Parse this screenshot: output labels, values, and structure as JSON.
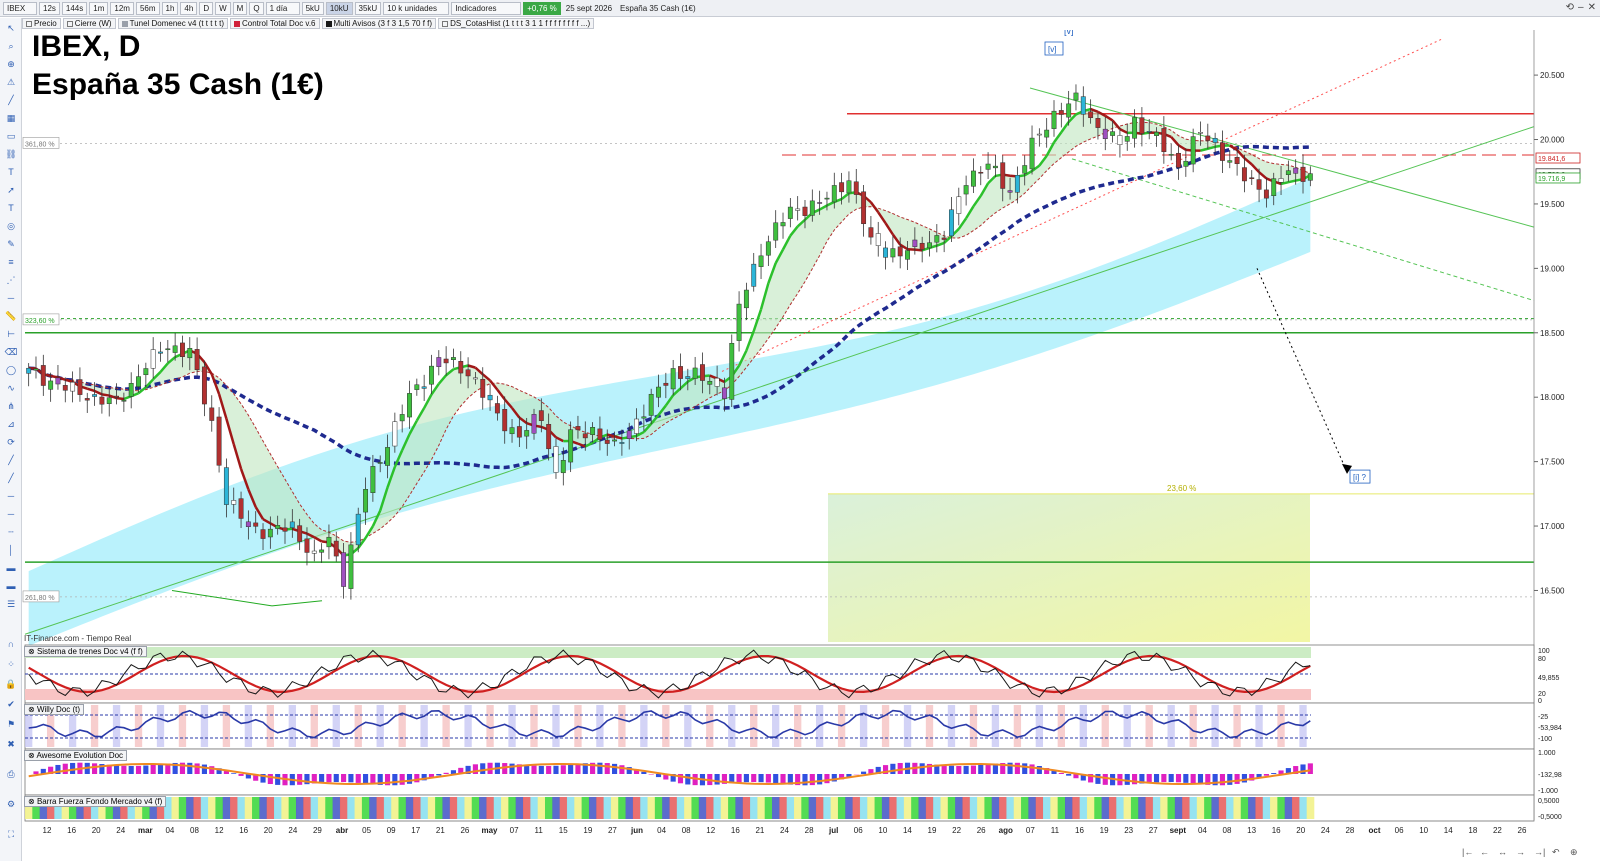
{
  "toolbar": {
    "symbol": "IBEX",
    "timeframes": [
      "12s",
      "144s",
      "1m",
      "12m",
      "56m",
      "1h",
      "4h",
      "D",
      "W",
      "M",
      "Q"
    ],
    "active_timeframe": "D",
    "period": "1 día",
    "volumes": [
      "5kU",
      "10kU",
      "35kU"
    ],
    "active_volume": "10kU",
    "units": "10 k unidades",
    "indicators_label": "Indicadores",
    "change_badge": "+0,76 %",
    "date": "25 sept 2026",
    "instrument": "España 35 Cash (1€)"
  },
  "indicator_tabs": [
    {
      "label": "Precio",
      "color": "#ffffff"
    },
    {
      "label": "Cierre (W)",
      "color": "#ffffff"
    },
    {
      "label": "Tunel Domenec v4 (t t t t t)",
      "color": "#9aa0aa"
    },
    {
      "label": "Control Total Doc v.6",
      "color": "#d0203a"
    },
    {
      "label": "Multi Avisos (3 f 3 1,5 70 f f)",
      "color": "#1a1a1a"
    },
    {
      "label": "DS_CotasHist (1 t t t 3 1 1 f f f f f f f f ...)",
      "color": "#ffffff"
    }
  ],
  "title": {
    "line1": "IBEX, D",
    "line2": "España 35 Cash (1€)"
  },
  "source": "IT-Finance.com - Tiempo Real",
  "price_axis": {
    "ticks": [
      "20.500",
      "20.000",
      "19.500",
      "19.000",
      "18.500",
      "18.000",
      "17.500",
      "17.000",
      "16.500"
    ],
    "tags": [
      {
        "label": "19.841,6",
        "color": "#cc2222",
        "value": 19841
      },
      {
        "label": "19.733,9",
        "color": "#333333",
        "value": 19734
      },
      {
        "label": "19.716,9",
        "color": "#2aa02a",
        "value": 19717
      }
    ]
  },
  "fib_labels": [
    {
      "label": "361,80 %",
      "value": 19970
    },
    {
      "label": "323,60 %",
      "value": 18600
    },
    {
      "label": "261,80 %",
      "value": 16450
    }
  ],
  "annotations": {
    "wave_top": "[v]",
    "wave_top2": "[v]",
    "target": "[i] ?",
    "fib_2360": "23,60 %"
  },
  "panels": [
    {
      "label": "Sistema de trenes Doc v4 (f f)",
      "axis": [
        "100",
        "80",
        "49,855",
        "20",
        "0"
      ]
    },
    {
      "label": "Willy Doc (t)",
      "axis": [
        "-25",
        "-53,984",
        "-100"
      ]
    },
    {
      "label": "Awesome Evolution Doc",
      "axis": [
        "1.000",
        "-132,98",
        "-1.000"
      ]
    },
    {
      "label": "Barra Fuerza Fondo Mercado v4 (f)",
      "axis": [
        "0,5000",
        "-0,5000"
      ]
    }
  ],
  "date_axis": {
    "labels": [
      "12",
      "16",
      "20",
      "24",
      "mar",
      "04",
      "08",
      "12",
      "16",
      "20",
      "24",
      "29",
      "abr",
      "05",
      "09",
      "17",
      "21",
      "26",
      "may",
      "07",
      "11",
      "15",
      "19",
      "27",
      "jun",
      "04",
      "08",
      "12",
      "16",
      "21",
      "24",
      "28",
      "jul",
      "06",
      "10",
      "14",
      "19",
      "22",
      "26",
      "ago",
      "07",
      "11",
      "16",
      "19",
      "23",
      "27",
      "sept",
      "04",
      "08",
      "13",
      "16",
      "20",
      "24",
      "28",
      "oct",
      "06",
      "10",
      "14",
      "18",
      "22",
      "26"
    ]
  },
  "chart_data": {
    "type": "candlestick",
    "title": "IBEX, D",
    "subtitle": "España 35 Cash (1€)",
    "ylim": [
      16100,
      20850
    ],
    "horizontal_levels": [
      {
        "value": 20200,
        "color": "#e03030",
        "style": "solid"
      },
      {
        "value": 19880,
        "color": "#e03030",
        "style": "dashed"
      },
      {
        "value": 18500,
        "color": "#2aa02a",
        "style": "solid"
      },
      {
        "value": 18610,
        "color": "#2aa02a",
        "style": "dotted"
      },
      {
        "value": 16720,
        "color": "#2aa02a",
        "style": "solid"
      }
    ],
    "close_keypoints": [
      [
        0,
        18200
      ],
      [
        6,
        18050
      ],
      [
        12,
        17950
      ],
      [
        16,
        18250
      ],
      [
        19,
        18400
      ],
      [
        22,
        18350
      ],
      [
        25,
        17800
      ],
      [
        27,
        17200
      ],
      [
        30,
        17000
      ],
      [
        33,
        16950
      ],
      [
        36,
        17000
      ],
      [
        39,
        16750
      ],
      [
        41,
        16900
      ],
      [
        43,
        16600
      ],
      [
        46,
        17300
      ],
      [
        49,
        17650
      ],
      [
        52,
        18000
      ],
      [
        56,
        18300
      ],
      [
        60,
        18200
      ],
      [
        64,
        17850
      ],
      [
        67,
        17700
      ],
      [
        70,
        17850
      ],
      [
        72,
        17400
      ],
      [
        74,
        17700
      ],
      [
        77,
        17750
      ],
      [
        80,
        17600
      ],
      [
        84,
        17900
      ],
      [
        88,
        18200
      ],
      [
        92,
        18150
      ],
      [
        95,
        18050
      ],
      [
        97,
        18700
      ],
      [
        100,
        19150
      ],
      [
        104,
        19450
      ],
      [
        108,
        19500
      ],
      [
        112,
        19700
      ],
      [
        115,
        19200
      ],
      [
        119,
        19100
      ],
      [
        122,
        19200
      ],
      [
        125,
        19250
      ],
      [
        128,
        19700
      ],
      [
        131,
        19800
      ],
      [
        134,
        19600
      ],
      [
        137,
        19950
      ],
      [
        140,
        20200
      ],
      [
        143,
        20300
      ],
      [
        146,
        20100
      ],
      [
        149,
        19950
      ],
      [
        151,
        20150
      ],
      [
        154,
        20000
      ],
      [
        157,
        19800
      ],
      [
        160,
        20050
      ],
      [
        163,
        19900
      ],
      [
        166,
        19700
      ],
      [
        169,
        19600
      ],
      [
        172,
        19750
      ],
      [
        175,
        19735
      ]
    ]
  }
}
